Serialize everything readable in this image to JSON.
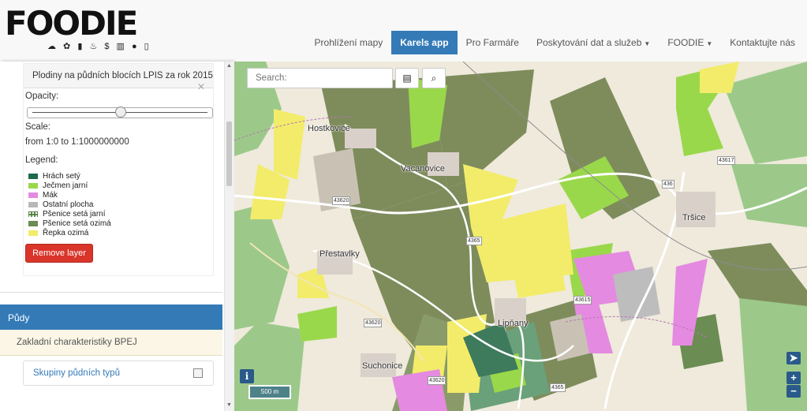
{
  "header": {
    "logo_text": "FOODIE",
    "logo_icons": "☁ ✿ ▮ ♨ $ ▥ ● ▯",
    "nav": [
      {
        "label": "Prohlížení mapy"
      },
      {
        "label": "Karels app",
        "active": true
      },
      {
        "label": "Pro Farmáře"
      },
      {
        "label": "Poskytování dat a služeb",
        "caret": true
      },
      {
        "label": "FOODIE",
        "caret": true
      },
      {
        "label": "Kontaktujte nás"
      }
    ]
  },
  "sidebar": {
    "layer_title": "Plodiny na půdních blocích LPIS za rok 2015",
    "opacity_label": "Opacity:",
    "opacity_value": 0.5,
    "scale_label": "Scale:",
    "scale_range": "from 1:0 to 1:1000000000",
    "legend_label": "Legend:",
    "legend": [
      {
        "name": "Hrách setý",
        "color": "#1e6b4e"
      },
      {
        "name": "Ječmen jarní",
        "color": "#9ad84b"
      },
      {
        "name": "Mák",
        "color": "#e48ae0"
      },
      {
        "name": "Ostatní plocha",
        "color": "#b8b8b8"
      },
      {
        "name": "Pšenice setá jarní",
        "color": "#4c7d3c"
      },
      {
        "name": "Pšenice setá ozimá",
        "color": "#6b8c52"
      },
      {
        "name": "Řepka ozimá",
        "color": "#f2ec6a"
      }
    ],
    "remove_button": "Remove layer",
    "section_title": "Půdy",
    "subsection": "Zakladní charakteristiky BPEJ",
    "sublayer": "Skupiny půdních typů"
  },
  "map": {
    "search_placeholder": "Search:",
    "towns": [
      "Hostkovice",
      "Vacanovice",
      "Tršice",
      "Přestavlky",
      "Lipňany",
      "Suchonice"
    ],
    "road_labels": [
      "43617",
      "436",
      "43620",
      "4365",
      "43615",
      "43620",
      "43620",
      "4365"
    ],
    "scale_text": "500 m",
    "info_label": "i",
    "zoom_in": "+",
    "zoom_out": "−",
    "colors": {
      "background": "#efeadc",
      "forest": "#9cc98a",
      "field_olive": "#7e8c5c",
      "yellow": "#f2ec6a",
      "lime": "#9ad84b",
      "pink": "#e48ae0"
    }
  }
}
